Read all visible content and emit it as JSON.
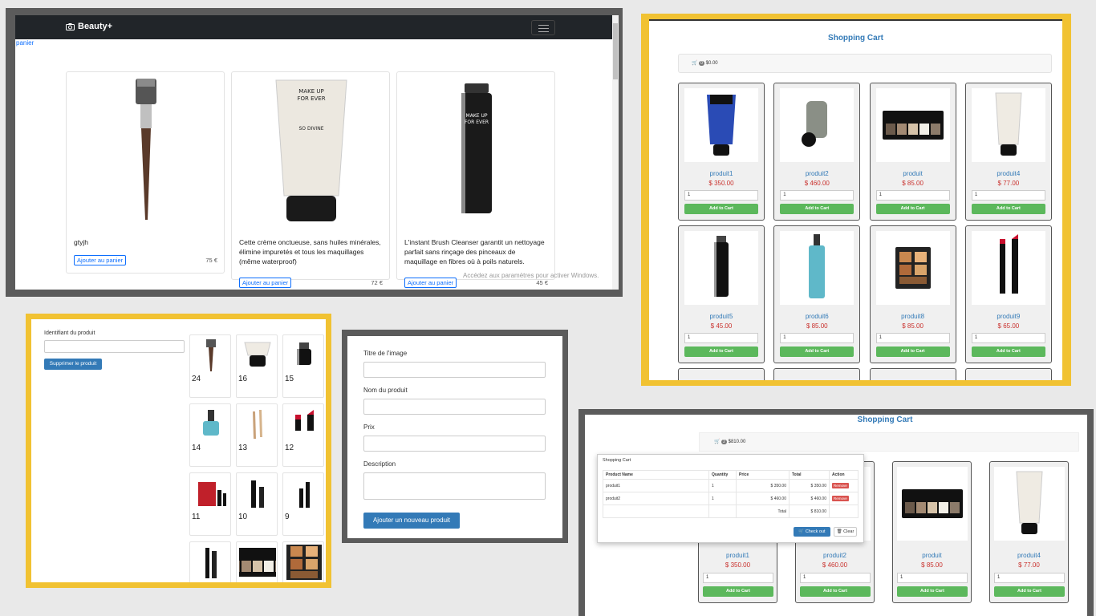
{
  "storefront": {
    "brand": "Beauty+",
    "panier_link": "panier",
    "products": [
      {
        "title": "gtyjh",
        "button": "Ajouter au panier",
        "price": "75 €"
      },
      {
        "title": "Cette crème onctueuse, sans huiles minérales, élimine impuretés et tous les maquillages (même waterproof)",
        "button": "Ajouter au panier",
        "price": "72 €"
      },
      {
        "title": "L'instant Brush Cleanser garantit un nettoyage parfait sans rinçage des pinceaux de maquillage en fibres où à poils naturels.",
        "button": "Ajouter au panier",
        "price": "45 €"
      }
    ],
    "watermark": "Accédez aux paramètres pour activer Windows."
  },
  "cart_grid": {
    "title": "Shopping Cart",
    "cart_total": "$0.00",
    "cart_count": "0",
    "qty_value": "1",
    "add_label": "Add to Cart",
    "products": [
      {
        "name": "produit1",
        "price": "$ 350.00",
        "icon": "tube-blue"
      },
      {
        "name": "produit2",
        "price": "$ 460.00",
        "icon": "jar"
      },
      {
        "name": "produit",
        "price": "$ 85.00",
        "icon": "palette"
      },
      {
        "name": "produit4",
        "price": "$ 77.00",
        "icon": "tube-white"
      },
      {
        "name": "produit5",
        "price": "$ 45.00",
        "icon": "spray"
      },
      {
        "name": "produit6",
        "price": "$ 85.00",
        "icon": "pump-blue"
      },
      {
        "name": "produit8",
        "price": "$ 85.00",
        "icon": "palette-warm"
      },
      {
        "name": "produit9",
        "price": "$ 65.00",
        "icon": "lipstick"
      }
    ]
  },
  "delete_panel": {
    "label": "Identifiant du produit",
    "button": "Supprimer le produit",
    "tiles": [
      {
        "num": "24",
        "icon": "brush"
      },
      {
        "num": "16",
        "icon": "tube-white"
      },
      {
        "num": "15",
        "icon": "spray"
      },
      {
        "num": "14",
        "icon": "pump-blue"
      },
      {
        "num": "13",
        "icon": "pencil"
      },
      {
        "num": "12",
        "icon": "lipstick"
      },
      {
        "num": "11",
        "icon": "red-box"
      },
      {
        "num": "10",
        "icon": "liner"
      },
      {
        "num": "9",
        "icon": "brushes"
      },
      {
        "num": "",
        "icon": "mascara"
      },
      {
        "num": "",
        "icon": "palette"
      },
      {
        "num": "",
        "icon": "palette-warm"
      }
    ]
  },
  "add_form": {
    "fields": [
      "Titre de l'image",
      "Nom du produit",
      "Prix",
      "Description"
    ],
    "submit": "Ajouter un nouveau produit"
  },
  "cart_dropdown": {
    "title": "Shopping Cart",
    "cart_total": "$810.00",
    "cart_count": "2",
    "dropdown_title": "Shopping Cart",
    "headers": [
      "Product Name",
      "Quantity",
      "Price",
      "Total",
      "Action"
    ],
    "rows": [
      {
        "name": "produit1",
        "qty": "1",
        "price": "$ 350.00",
        "total": "$ 350.00",
        "action": "Remove"
      },
      {
        "name": "produit2",
        "qty": "1",
        "price": "$ 460.00",
        "total": "$ 460.00",
        "action": "Remove"
      }
    ],
    "total_label": "Total",
    "total_value": "$ 810.00",
    "checkout": "Check out",
    "clear": "Clear",
    "add_label": "Add to Cart",
    "products": [
      {
        "name": "produit1",
        "price": "$ 350.00",
        "qty": "1"
      },
      {
        "name": "produit2",
        "price": "$ 460.00",
        "qty": "1"
      },
      {
        "name": "produit",
        "price": "$ 85.00",
        "qty": "1"
      },
      {
        "name": "produit4",
        "price": "$ 77.00",
        "qty": "1"
      }
    ]
  },
  "colors": {
    "accent": "#337ab7",
    "success": "#5cb85c",
    "danger": "#d9534f",
    "frame_yellow": "#f1c232",
    "frame_gray": "#5b5b5b"
  }
}
